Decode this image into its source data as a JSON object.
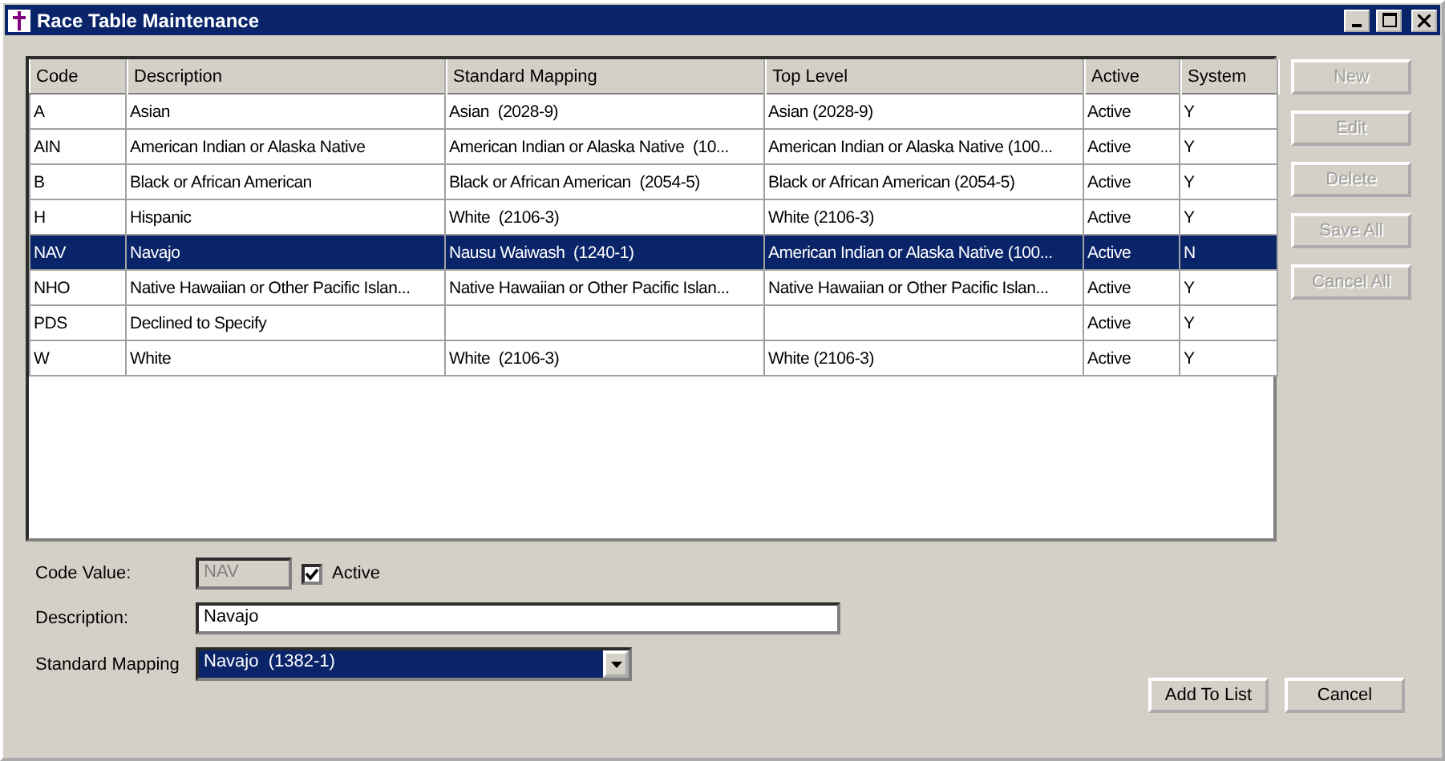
{
  "window": {
    "title": "Race Table Maintenance"
  },
  "table": {
    "columns": [
      "Code",
      "Description",
      "Standard Mapping",
      "Top Level",
      "Active",
      "System"
    ],
    "rows": [
      {
        "cells": [
          "A",
          "Asian",
          "Asian  (2028-9)",
          "Asian (2028-9)",
          "Active",
          "Y"
        ],
        "selected": false
      },
      {
        "cells": [
          "AIN",
          "American Indian or Alaska Native",
          "American Indian or Alaska Native  (10...",
          "American Indian or Alaska Native (100...",
          "Active",
          "Y"
        ],
        "selected": false
      },
      {
        "cells": [
          "B",
          "Black or African American",
          "Black or African American  (2054-5)",
          "Black or African American (2054-5)",
          "Active",
          "Y"
        ],
        "selected": false
      },
      {
        "cells": [
          "H",
          "Hispanic",
          "White  (2106-3)",
          "White (2106-3)",
          "Active",
          "Y"
        ],
        "selected": false
      },
      {
        "cells": [
          "NAV",
          "Navajo",
          "Nausu Waiwash  (1240-1)",
          "American Indian or Alaska Native (100...",
          "Active",
          "N"
        ],
        "selected": true
      },
      {
        "cells": [
          "NHO",
          "Native Hawaiian or Other Pacific Islan...",
          "Native Hawaiian or Other Pacific Islan...",
          "Native Hawaiian or Other Pacific Islan...",
          "Active",
          "Y"
        ],
        "selected": false
      },
      {
        "cells": [
          "PDS",
          "Declined to Specify",
          "",
          "",
          "Active",
          "Y"
        ],
        "selected": false
      },
      {
        "cells": [
          "W",
          "White",
          "White  (2106-3)",
          "White (2106-3)",
          "Active",
          "Y"
        ],
        "selected": false
      }
    ]
  },
  "side_buttons": [
    {
      "label": "New",
      "disabled": true
    },
    {
      "label": "Edit",
      "disabled": true
    },
    {
      "label": "Delete",
      "disabled": true
    },
    {
      "label": "Save All",
      "disabled": true
    },
    {
      "label": "Cancel All",
      "disabled": true
    }
  ],
  "form": {
    "code_label": "Code Value:",
    "code_value": "NAV",
    "code_disabled": true,
    "active_label": "Active",
    "active_checked": true,
    "description_label": "Description:",
    "description_value": "Navajo",
    "mapping_label": "Standard Mapping",
    "mapping_value": "Navajo  (1382-1)"
  },
  "buttons": [
    "Add To List",
    "Cancel"
  ]
}
